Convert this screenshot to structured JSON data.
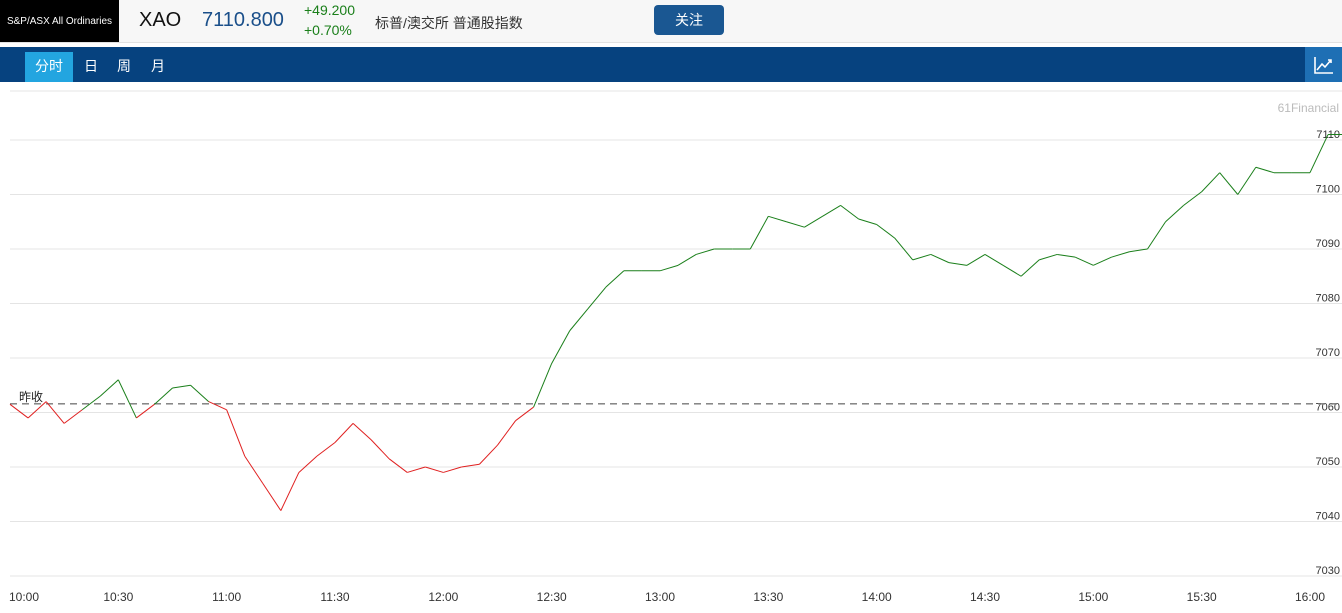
{
  "header": {
    "index_name": "S&P/ASX All Ordinaries",
    "symbol": "XAO",
    "price": "7110.800",
    "change": "+49.200",
    "change_pct": "+0.70%",
    "description": "标普/澳交所 普通股指数",
    "follow_label": "关注"
  },
  "tabs": [
    {
      "label": "分时",
      "active": true
    },
    {
      "label": "日",
      "active": false
    },
    {
      "label": "周",
      "active": false
    },
    {
      "label": "月",
      "active": false
    }
  ],
  "toolbar": {
    "chart_icon": "line-chart-icon"
  },
  "colors": {
    "up": "#1a7f1a",
    "down": "#e02020",
    "price": "#1a4f8a",
    "header_dark": "#06427f",
    "tab_active": "#23a5e0",
    "button": "#1a5792"
  },
  "chart_data": {
    "type": "line",
    "watermark": "61Financial",
    "prev_close_label": "昨收",
    "prev_close": 7061.6,
    "ylim": [
      7030,
      7110
    ],
    "y_ticks": [
      "7110",
      "7100",
      "7090",
      "7080",
      "7070",
      "7060",
      "7050",
      "7040",
      "7030"
    ],
    "x_ticks": [
      "10:00",
      "10:30",
      "11:00",
      "11:30",
      "12:00",
      "12:30",
      "13:00",
      "13:30",
      "14:00",
      "14:30",
      "15:00",
      "15:30",
      "16:00"
    ],
    "series": [
      {
        "x": [
          "10:00",
          "10:05",
          "10:10",
          "10:15",
          "10:20",
          "10:25",
          "10:30",
          "10:35",
          "10:40",
          "10:45",
          "10:50",
          "10:55",
          "11:00",
          "11:05",
          "11:10",
          "11:15",
          "11:20",
          "11:25",
          "11:30",
          "11:35",
          "11:40",
          "11:45",
          "11:50",
          "11:55",
          "12:00",
          "12:05",
          "12:10",
          "12:15",
          "12:20",
          "12:25",
          "12:30",
          "12:35",
          "12:40",
          "12:45",
          "12:50",
          "12:55",
          "13:00",
          "13:05",
          "13:10",
          "13:15",
          "13:20",
          "13:25",
          "13:30",
          "13:35",
          "13:40",
          "13:45",
          "13:50",
          "13:55",
          "14:00",
          "14:05",
          "14:10",
          "14:15",
          "14:20",
          "14:25",
          "14:30",
          "14:35",
          "14:40",
          "14:45",
          "14:50",
          "14:55",
          "15:00",
          "15:05",
          "15:10",
          "15:15",
          "15:20",
          "15:25",
          "15:30",
          "15:35",
          "15:40",
          "15:45",
          "15:50",
          "15:55",
          "16:00",
          "16:05",
          "16:10"
        ],
        "values": [
          7061.5,
          7059.0,
          7062.0,
          7058.0,
          7060.5,
          7063.0,
          7066.0,
          7059.0,
          7061.5,
          7064.5,
          7065.0,
          7062.0,
          7060.5,
          7052.0,
          7047.0,
          7042.0,
          7049.0,
          7052.0,
          7054.5,
          7058.0,
          7055.0,
          7051.5,
          7049.0,
          7050.0,
          7049.0,
          7050.0,
          7050.5,
          7054.0,
          7058.5,
          7061.0,
          7069.0,
          7075.0,
          7079.0,
          7083.0,
          7086.0,
          7086.0,
          7086.0,
          7087.0,
          7089.0,
          7090.0,
          7090.0,
          7090.0,
          7096.0,
          7095.0,
          7094.0,
          7096.0,
          7098.0,
          7095.5,
          7094.5,
          7092.0,
          7088.0,
          7089.0,
          7087.5,
          7087.0,
          7089.0,
          7087.0,
          7085.0,
          7088.0,
          7089.0,
          7088.5,
          7087.0,
          7088.5,
          7089.5,
          7090.0,
          7095.0,
          7098.0,
          7100.5,
          7104.0,
          7100.0,
          7105.0,
          7104.0,
          7104.0,
          7104.0,
          7111.0,
          7111.0
        ]
      }
    ]
  }
}
